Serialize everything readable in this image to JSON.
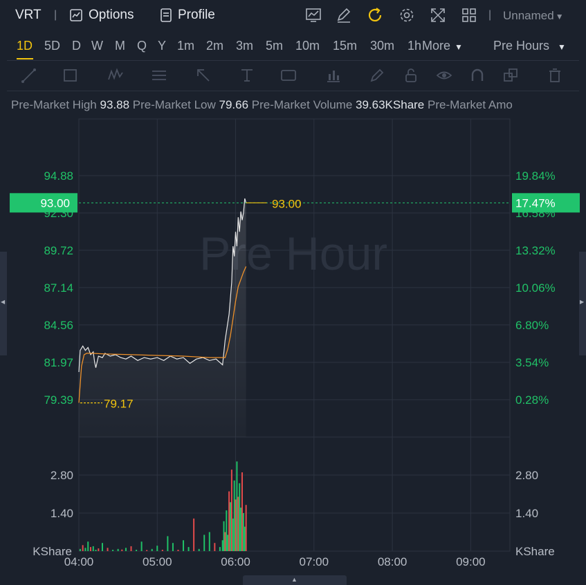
{
  "header": {
    "ticker": "VRT",
    "options_label": "Options",
    "profile_label": "Profile",
    "layout_name": "Unnamed",
    "icons": [
      "indicator-chart-icon",
      "draw-pen-icon",
      "refresh-icon",
      "settings-gear-icon",
      "fullscreen-icon",
      "layout-grid-icon"
    ],
    "refresh_color": "#f2c40f"
  },
  "timeframes": {
    "items": [
      "1D",
      "5D",
      "D",
      "W",
      "M",
      "Q",
      "Y",
      "1m",
      "2m",
      "3m",
      "5m",
      "10m",
      "15m",
      "30m",
      "1h"
    ],
    "active": "1D",
    "more_label": "More",
    "session_label": "Pre Hours"
  },
  "drawing_tools": [
    "trend-line-icon",
    "rectangle-icon",
    "pattern-icon",
    "fib-icon",
    "arrow-icon",
    "text-icon",
    "label-icon",
    "measure-icon",
    "brush-icon",
    "lock-icon",
    "eye-icon",
    "magnet-icon",
    "copy-icon",
    "trash-icon"
  ],
  "stats": {
    "high_label": "Pre-Market High",
    "high_value": "93.88",
    "low_label": "Pre-Market Low",
    "low_value": "79.66",
    "volume_label": "Pre-Market Volume",
    "volume_value": "39.63KShare",
    "amount_label": "Pre-Market Amo"
  },
  "colors": {
    "up": "#20c167",
    "down": "#e14b4b",
    "price_line": "#e8e8e8",
    "avg_line": "#f0922b",
    "marker": "#f2c40f",
    "badge": "#21c36d"
  },
  "chart_data": {
    "type": "line",
    "watermark": "Pre Hour",
    "price_axis": {
      "ticks": [
        "94.88",
        "92.30",
        "89.72",
        "87.14",
        "84.56",
        "81.97",
        "79.39"
      ],
      "tick_values": [
        94.88,
        92.3,
        89.72,
        87.14,
        84.56,
        81.97,
        79.39
      ]
    },
    "percent_axis": {
      "ticks": [
        "19.84%",
        "16.58%",
        "13.32%",
        "10.06%",
        "6.80%",
        "3.54%",
        "0.28%"
      ]
    },
    "volume_axis": {
      "ticks": [
        "2.80",
        "1.40"
      ],
      "tick_values": [
        2.8,
        1.4
      ],
      "unit": "KShare"
    },
    "x_ticks": [
      "04:00",
      "05:00",
      "06:00",
      "07:00",
      "08:00",
      "09:00"
    ],
    "x_tick_minutes": [
      0,
      60,
      120,
      180,
      240,
      300
    ],
    "current_price": "93.00",
    "current_pct": "17.47%",
    "low_marker": "79.17",
    "current_value": 93.0,
    "low_value": 79.17,
    "series": [
      {
        "name": "",
        "role": "price",
        "x": [
          0,
          1,
          3,
          5,
          7,
          9,
          11,
          12,
          13,
          15,
          18,
          20,
          24,
          28,
          32,
          36,
          40,
          45,
          50,
          55,
          60,
          65,
          70,
          75,
          80,
          85,
          90,
          95,
          100,
          105,
          110,
          112,
          115,
          117,
          118,
          119,
          120,
          121,
          122,
          123,
          124,
          125,
          126,
          127,
          128
        ],
        "y": [
          81.3,
          82.8,
          83.1,
          82.8,
          83.0,
          82.5,
          82.7,
          82.0,
          81.6,
          82.4,
          82.3,
          82.6,
          82.4,
          82.5,
          82.3,
          82.2,
          82.4,
          82.1,
          82.3,
          82.2,
          82.3,
          82.1,
          82.4,
          82.2,
          82.3,
          81.9,
          82.2,
          82.3,
          82.1,
          82.2,
          81.8,
          83.5,
          85.3,
          87.5,
          90.0,
          89.3,
          91.0,
          90.0,
          92.0,
          91.0,
          92.4,
          91.8,
          92.3,
          93.3,
          93.0
        ]
      },
      {
        "name": "",
        "role": "average",
        "x": [
          0,
          2,
          4,
          6,
          10,
          20,
          40,
          60,
          80,
          100,
          112,
          114,
          116,
          118,
          120,
          122,
          124,
          126,
          128
        ],
        "y": [
          79.17,
          81.7,
          82.5,
          82.6,
          82.6,
          82.55,
          82.5,
          82.45,
          82.4,
          82.3,
          82.3,
          82.9,
          83.8,
          85.0,
          86.2,
          87.2,
          87.7,
          88.2,
          88.6
        ]
      }
    ],
    "volume": {
      "x": [
        1,
        3,
        5,
        7,
        9,
        11,
        13,
        15,
        18,
        22,
        26,
        30,
        33,
        36,
        40,
        44,
        48,
        52,
        56,
        60,
        64,
        68,
        72,
        76,
        80,
        84,
        88,
        92,
        96,
        100,
        104,
        108,
        110,
        111,
        112,
        113,
        114,
        115,
        116,
        117,
        118,
        119,
        120,
        121,
        122,
        123,
        124,
        125,
        126,
        127,
        128
      ],
      "v": [
        0.08,
        0.22,
        0.12,
        0.35,
        0.15,
        0.18,
        0.05,
        0.1,
        0.3,
        0.12,
        0.05,
        0.08,
        0.06,
        0.12,
        0.18,
        0.05,
        0.35,
        0.04,
        0.08,
        0.2,
        0.05,
        0.55,
        0.3,
        0.05,
        0.4,
        0.15,
        1.2,
        0.08,
        0.6,
        0.7,
        0.3,
        0.15,
        0.4,
        1.1,
        0.7,
        1.5,
        0.6,
        2.2,
        1.8,
        3.0,
        1.2,
        2.6,
        1.9,
        3.3,
        2.0,
        2.5,
        1.6,
        2.9,
        1.4,
        0.9,
        1.7
      ],
      "up": [
        true,
        false,
        true,
        true,
        false,
        true,
        true,
        false,
        true,
        false,
        true,
        true,
        false,
        true,
        false,
        true,
        true,
        false,
        true,
        true,
        false,
        true,
        true,
        false,
        true,
        true,
        false,
        true,
        true,
        true,
        false,
        true,
        true,
        true,
        false,
        true,
        true,
        false,
        true,
        false,
        true,
        true,
        false,
        true,
        false,
        true,
        true,
        false,
        true,
        true,
        false
      ]
    }
  }
}
